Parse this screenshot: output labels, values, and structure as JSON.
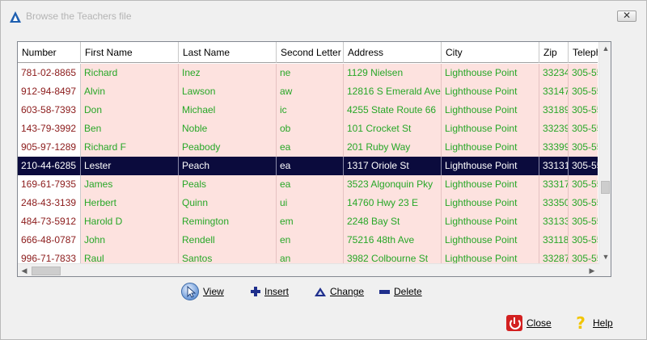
{
  "window": {
    "title": "Browse the Teachers file",
    "close_glyph": "✕"
  },
  "grid": {
    "columns": [
      "Number",
      "First Name",
      "Last Name",
      "Second Letter",
      "Address",
      "City",
      "Zip",
      "Teleph"
    ],
    "selected_row": 5,
    "rows": [
      [
        "781-02-8865",
        "Richard",
        "Inez",
        "ne",
        "1129 Nielsen",
        "Lighthouse Point",
        "33234",
        "305-55"
      ],
      [
        "912-94-8497",
        "Alvin",
        "Lawson",
        "aw",
        "12816 S Emerald Ave",
        "Lighthouse Point",
        "33147",
        "305-55"
      ],
      [
        "603-58-7393",
        "Don",
        "Michael",
        "ic",
        "4255 State Route 66",
        "Lighthouse Point",
        "33189",
        "305-55"
      ],
      [
        "143-79-3992",
        "Ben",
        "Noble",
        "ob",
        "101 Crocket St",
        "Lighthouse Point",
        "33239",
        "305-55"
      ],
      [
        "905-97-1289",
        "Richard F",
        "Peabody",
        "ea",
        "201 Ruby Way",
        "Lighthouse Point",
        "33399",
        "305-55"
      ],
      [
        "210-44-6285",
        "Lester",
        "Peach",
        "ea",
        "1317 Oriole St",
        "Lighthouse Point",
        "33131",
        "305-55"
      ],
      [
        "169-61-7935",
        "James",
        "Peals",
        "ea",
        "3523 Algonquin Pky",
        "Lighthouse Point",
        "33317",
        "305-55"
      ],
      [
        "248-43-3139",
        "Herbert",
        "Quinn",
        "ui",
        "14760 Hwy 23 E",
        "Lighthouse Point",
        "33350",
        "305-55"
      ],
      [
        "484-73-5912",
        "Harold D",
        "Remington",
        "em",
        "2248 Bay St",
        "Lighthouse Point",
        "33133",
        "305-55"
      ],
      [
        "666-48-0787",
        "John",
        "Rendell",
        "en",
        "75216 48th Ave",
        "Lighthouse Point",
        "33118",
        "305-55"
      ],
      [
        "996-71-7833",
        "Raul",
        "Santos",
        "an",
        "3982 Colbourne St",
        "Lighthouse Point",
        "33287",
        "305-55"
      ]
    ]
  },
  "toolbar": {
    "view": "View",
    "insert": "Insert",
    "change": "Change",
    "delete": "Delete"
  },
  "footer": {
    "close": "Close",
    "help": "Help",
    "help_glyph": "?"
  },
  "icons": {
    "app": "app-logo-icon",
    "view": "pointer-view-icon",
    "insert": "plus-icon",
    "change": "triangle-change-icon",
    "delete": "minus-icon",
    "close": "power-close-icon",
    "help": "question-help-icon"
  },
  "colors": {
    "number_text": "#8b1a1a",
    "cell_text": "#27a727",
    "cell_bg": "#fde2df",
    "selected_bg": "#0b0b3d",
    "toolbar_icon": "#1f2f8c"
  }
}
